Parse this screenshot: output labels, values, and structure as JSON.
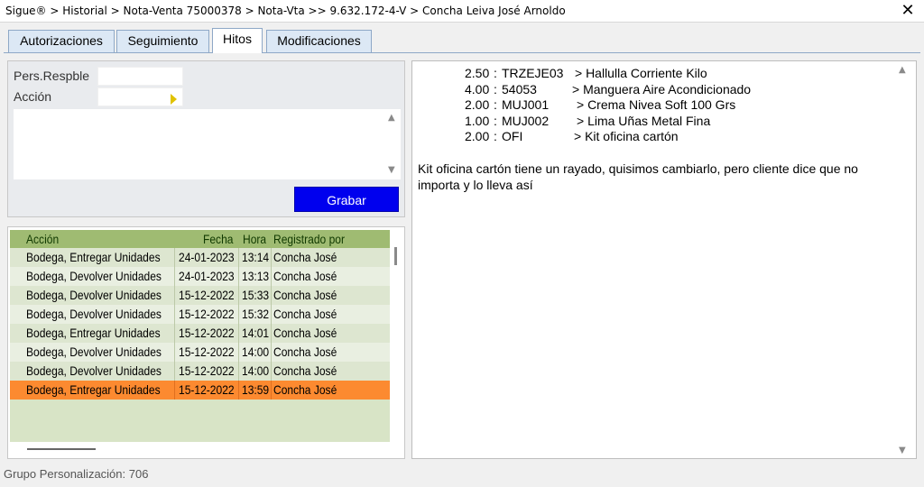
{
  "window": {
    "title": "Sigue® > Historial > Nota-Venta 75000378 > Nota-Vta  >> 9.632.172-4-V  > Concha Leiva José Arnoldo",
    "close_glyph": "✕"
  },
  "tabs": [
    {
      "label": "Autorizaciones",
      "active": false
    },
    {
      "label": "Seguimiento",
      "active": false
    },
    {
      "label": "Hitos",
      "active": true
    },
    {
      "label": "Modificaciones",
      "active": false
    }
  ],
  "form": {
    "pers_label": "Pers.Respble",
    "pers_value": "",
    "accion_label": "Acción",
    "accion_value": "",
    "notes_value": "",
    "save_label": "Grabar"
  },
  "grid": {
    "columns": [
      "Acción",
      "Fecha",
      "Hora",
      "Registrado por"
    ],
    "rows": [
      {
        "accion": "Bodega, Entregar Unidades",
        "fecha": "24-01-2023",
        "hora": "13:14",
        "registrado": "Concha José"
      },
      {
        "accion": "Bodega, Devolver Unidades",
        "fecha": "24-01-2023",
        "hora": "13:13",
        "registrado": "Concha José"
      },
      {
        "accion": "Bodega, Devolver Unidades",
        "fecha": "15-12-2022",
        "hora": "15:33",
        "registrado": "Concha José"
      },
      {
        "accion": "Bodega, Devolver Unidades",
        "fecha": "15-12-2022",
        "hora": "15:32",
        "registrado": "Concha José"
      },
      {
        "accion": "Bodega, Entregar Unidades",
        "fecha": "15-12-2022",
        "hora": "14:01",
        "registrado": "Concha José"
      },
      {
        "accion": "Bodega, Devolver Unidades",
        "fecha": "15-12-2022",
        "hora": "14:00",
        "registrado": "Concha José"
      },
      {
        "accion": "Bodega, Devolver Unidades",
        "fecha": "15-12-2022",
        "hora": "14:00",
        "registrado": "Concha José"
      },
      {
        "accion": "Bodega, Entregar Unidades",
        "fecha": "15-12-2022",
        "hora": "13:59",
        "registrado": "Concha José"
      }
    ],
    "selected_index": 7
  },
  "detail": {
    "items": [
      {
        "qty": "2.50",
        "code": "TRZEJE03",
        "desc": "> Hallulla Corriente Kilo"
      },
      {
        "qty": "4.00",
        "code": "54053",
        "desc": "> Manguera Aire Acondicionado"
      },
      {
        "qty": "2.00",
        "code": "MUJ001",
        "desc": "> Crema Nivea Soft 100 Grs"
      },
      {
        "qty": "1.00",
        "code": "MUJ002",
        "desc": "> Lima Uñas Metal Fina"
      },
      {
        "qty": "2.00",
        "code": "OFI",
        "desc": "> Kit oficina cartón"
      }
    ],
    "comment_line1": "Kit oficina cartón tiene un rayado, quisimos cambiarlo, pero cliente dice que no",
    "comment_line2": "importa y lo lleva así"
  },
  "status": {
    "text": "Grupo Personalización: 706"
  },
  "icons": {
    "scroll_up": "▲",
    "scroll_down": "▼"
  },
  "colors": {
    "selected_row": "#fc8a30",
    "save_button": "#0000ee",
    "grid_header": "#9fbb72"
  }
}
